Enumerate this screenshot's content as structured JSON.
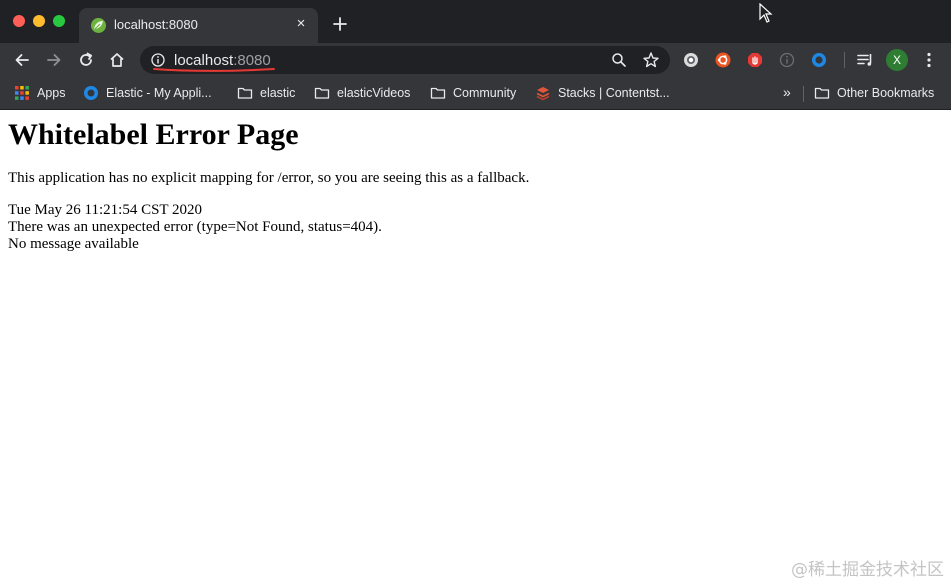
{
  "browser": {
    "tab": {
      "title": "localhost:8080",
      "close_glyph": "×",
      "favicon": "spring-leaf-icon"
    },
    "new_tab_icon": "plus-icon",
    "toolbar": {
      "url_host": "localhost",
      "url_port": ":8080",
      "avatar_initial": "X",
      "extensions": [
        "record-icon",
        "ubuntu-icon",
        "adblock-hand-icon",
        "info-icon",
        "circle-blue-icon"
      ],
      "colors": {
        "underline_annotation": "#e53935",
        "avatar_background": "#2e7d32"
      }
    },
    "bookmarks": {
      "items": [
        {
          "label": "Apps",
          "icon": "apps-grid-icon"
        },
        {
          "label": "Elastic - My Appli...",
          "icon": "elastic-icon"
        },
        {
          "label": "elastic",
          "icon": "folder-icon"
        },
        {
          "label": "elasticVideos",
          "icon": "folder-icon"
        },
        {
          "label": "Community",
          "icon": "folder-icon"
        },
        {
          "label": "Stacks | Contentst...",
          "icon": "contentstack-icon"
        }
      ],
      "more_glyph": "»",
      "other_label": "Other Bookmarks"
    }
  },
  "page": {
    "heading": "Whitelabel Error Page",
    "message": "This application has no explicit mapping for /error, so you are seeing this as a fallback.",
    "timestamp": "Tue May 26 11:21:54 CST 2020",
    "error_line": "There was an unexpected error (type=Not Found, status=404).",
    "detail": "No message available"
  },
  "watermark": "@稀土掘金技术社区"
}
